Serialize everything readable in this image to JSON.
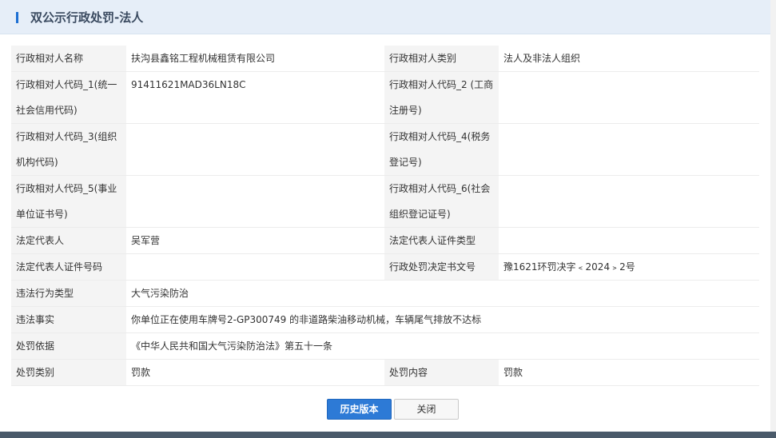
{
  "header": {
    "title": "双公示行政处罚-法人"
  },
  "rows": [
    {
      "l1": "行政相对人名称",
      "v1": "扶沟县鑫铭工程机械租赁有限公司",
      "l2": "行政相对人类别",
      "v2": "法人及非法人组织"
    },
    {
      "l1": "行政相对人代码_1(统一社会信用代码)",
      "v1": "91411621MAD36LN18C",
      "l2": "行政相对人代码_2 (工商注册号)",
      "v2": ""
    },
    {
      "l1": "行政相对人代码_3(组织机构代码)",
      "v1": "",
      "l2": "行政相对人代码_4(税务登记号)",
      "v2": ""
    },
    {
      "l1": "行政相对人代码_5(事业单位证书号)",
      "v1": "",
      "l2": "行政相对人代码_6(社会组织登记证号)",
      "v2": ""
    },
    {
      "l1": "法定代表人",
      "v1": "吴军营",
      "l2": "法定代表人证件类型",
      "v2": ""
    },
    {
      "l1": "法定代表人证件号码",
      "v1": "",
      "l2": "行政处罚决定书文号",
      "v2": "豫1621环罚决字﹤2024﹥2号"
    },
    {
      "l1": "违法行为类型",
      "v1": "大气污染防治"
    },
    {
      "l1": "违法事实",
      "v1": "你单位正在使用车牌号2-GP300749 的非道路柴油移动机械，车辆尾气排放不达标"
    },
    {
      "l1": "处罚依据",
      "v1": "《中华人民共和国大气污染防治法》第五十一条"
    },
    {
      "l1": "处罚类别",
      "v1": "罚款",
      "l2": "处罚内容",
      "v2": "罚款"
    }
  ],
  "buttons": {
    "history": "历史版本",
    "close": "关闭"
  }
}
